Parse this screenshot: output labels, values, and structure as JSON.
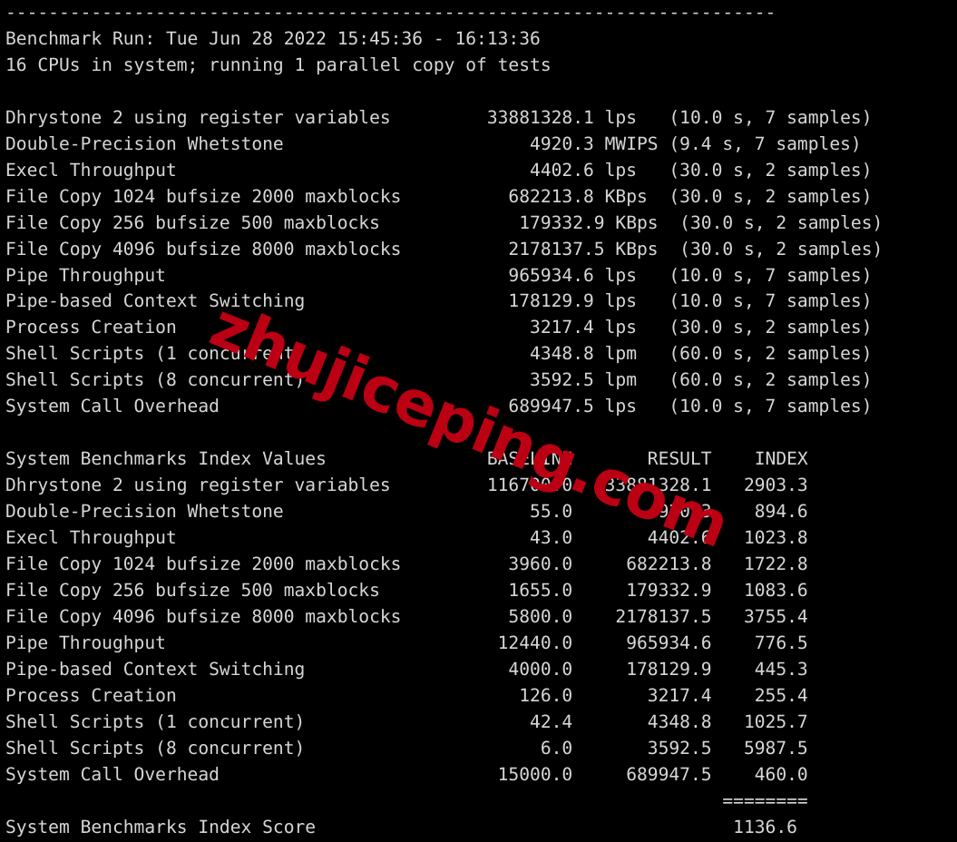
{
  "terminal": {
    "background_color": "#000000",
    "text_color": "#d6d6d6",
    "top_rule": "------------------------------------------------------------------------",
    "header": {
      "run_line": "Benchmark Run: Tue Jun 28 2022 15:45:36 - 16:13:36",
      "cpu_line": "16 CPUs in system; running 1 parallel copy of tests"
    },
    "results": {
      "rows": [
        {
          "name": "Dhrystone 2 using register variables",
          "value": "33881328.1",
          "unit": "lps",
          "detail": "(10.0 s, 7 samples)"
        },
        {
          "name": "Double-Precision Whetstone",
          "value": "4920.3",
          "unit": "MWIPS",
          "detail": "(9.4 s, 7 samples)"
        },
        {
          "name": "Execl Throughput",
          "value": "4402.6",
          "unit": "lps",
          "detail": "(30.0 s, 2 samples)"
        },
        {
          "name": "File Copy 1024 bufsize 2000 maxblocks",
          "value": "682213.8",
          "unit": "KBps",
          "detail": "(30.0 s, 2 samples)"
        },
        {
          "name": "File Copy 256 bufsize 500 maxblocks",
          "value": "179332.9",
          "unit": "KBps",
          "detail": "(30.0 s, 2 samples)"
        },
        {
          "name": "File Copy 4096 bufsize 8000 maxblocks",
          "value": "2178137.5",
          "unit": "KBps",
          "detail": "(30.0 s, 2 samples)"
        },
        {
          "name": "Pipe Throughput",
          "value": "965934.6",
          "unit": "lps",
          "detail": "(10.0 s, 7 samples)"
        },
        {
          "name": "Pipe-based Context Switching",
          "value": "178129.9",
          "unit": "lps",
          "detail": "(10.0 s, 7 samples)"
        },
        {
          "name": "Process Creation",
          "value": "3217.4",
          "unit": "lps",
          "detail": "(30.0 s, 2 samples)"
        },
        {
          "name": "Shell Scripts (1 concurrent)",
          "value": "4348.8",
          "unit": "lpm",
          "detail": "(60.0 s, 2 samples)"
        },
        {
          "name": "Shell Scripts (8 concurrent)",
          "value": "3592.5",
          "unit": "lpm",
          "detail": "(60.0 s, 2 samples)"
        },
        {
          "name": "System Call Overhead",
          "value": "689947.5",
          "unit": "lps",
          "detail": "(10.0 s, 7 samples)"
        }
      ]
    },
    "index_table": {
      "title": "System Benchmarks Index Values",
      "columns": [
        "BASELINE",
        "RESULT",
        "INDEX"
      ],
      "rows": [
        {
          "name": "Dhrystone 2 using register variables",
          "baseline": "116700.0",
          "result": "33881328.1",
          "index": "2903.3"
        },
        {
          "name": "Double-Precision Whetstone",
          "baseline": "55.0",
          "result": "4920.3",
          "index": "894.6"
        },
        {
          "name": "Execl Throughput",
          "baseline": "43.0",
          "result": "4402.6",
          "index": "1023.8"
        },
        {
          "name": "File Copy 1024 bufsize 2000 maxblocks",
          "baseline": "3960.0",
          "result": "682213.8",
          "index": "1722.8"
        },
        {
          "name": "File Copy 256 bufsize 500 maxblocks",
          "baseline": "1655.0",
          "result": "179332.9",
          "index": "1083.6"
        },
        {
          "name": "File Copy 4096 bufsize 8000 maxblocks",
          "baseline": "5800.0",
          "result": "2178137.5",
          "index": "3755.4"
        },
        {
          "name": "Pipe Throughput",
          "baseline": "12440.0",
          "result": "965934.6",
          "index": "776.5"
        },
        {
          "name": "Pipe-based Context Switching",
          "baseline": "4000.0",
          "result": "178129.9",
          "index": "445.3"
        },
        {
          "name": "Process Creation",
          "baseline": "126.0",
          "result": "3217.4",
          "index": "255.4"
        },
        {
          "name": "Shell Scripts (1 concurrent)",
          "baseline": "42.4",
          "result": "4348.8",
          "index": "1025.7"
        },
        {
          "name": "Shell Scripts (8 concurrent)",
          "baseline": "6.0",
          "result": "3592.5",
          "index": "5987.5"
        },
        {
          "name": "System Call Overhead",
          "baseline": "15000.0",
          "result": "689947.5",
          "index": "460.0"
        }
      ],
      "separator": "========",
      "score_label": "System Benchmarks Index Score",
      "score_value": "1136.6"
    },
    "full_text": "------------------------------------------------------------------------\nBenchmark Run: Tue Jun 28 2022 15:45:36 - 16:13:36\n16 CPUs in system; running 1 parallel copy of tests\n\nDhrystone 2 using register variables         33881328.1 lps   (10.0 s, 7 samples)\nDouble-Precision Whetstone                       4920.3 MWIPS (9.4 s, 7 samples)\nExecl Throughput                                 4402.6 lps   (30.0 s, 2 samples)\nFile Copy 1024 bufsize 2000 maxblocks          682213.8 KBps  (30.0 s, 2 samples)\nFile Copy 256 bufsize 500 maxblocks             179332.9 KBps  (30.0 s, 2 samples)\nFile Copy 4096 bufsize 8000 maxblocks          2178137.5 KBps  (30.0 s, 2 samples)\nPipe Throughput                                965934.6 lps   (10.0 s, 7 samples)\nPipe-based Context Switching                   178129.9 lps   (10.0 s, 7 samples)\nProcess Creation                                 3217.4 lps   (30.0 s, 2 samples)\nShell Scripts (1 concurrent)                     4348.8 lpm   (60.0 s, 2 samples)\nShell Scripts (8 concurrent)                     3592.5 lpm   (60.0 s, 2 samples)\nSystem Call Overhead                           689947.5 lps   (10.0 s, 7 samples)\n\nSystem Benchmarks Index Values               BASELINE       RESULT    INDEX\nDhrystone 2 using register variables         116700.0   33881328.1   2903.3\nDouble-Precision Whetstone                       55.0       4920.3    894.6\nExecl Throughput                                 43.0       4402.6   1023.8\nFile Copy 1024 bufsize 2000 maxblocks          3960.0     682213.8   1722.8\nFile Copy 256 bufsize 500 maxblocks            1655.0     179332.9   1083.6\nFile Copy 4096 bufsize 8000 maxblocks          5800.0    2178137.5   3755.4\nPipe Throughput                               12440.0     965934.6    776.5\nPipe-based Context Switching                   4000.0     178129.9    445.3\nProcess Creation                                126.0       3217.4    255.4\nShell Scripts (1 concurrent)                     42.4       4348.8   1025.7\nShell Scripts (8 concurrent)                      6.0       3592.5   5987.5\nSystem Call Overhead                          15000.0     689947.5    460.0\n                                                                   ========\nSystem Benchmarks Index Score                                       1136.6"
  },
  "watermark": {
    "text": "zhujiceping.com",
    "color": "#bb0014"
  }
}
